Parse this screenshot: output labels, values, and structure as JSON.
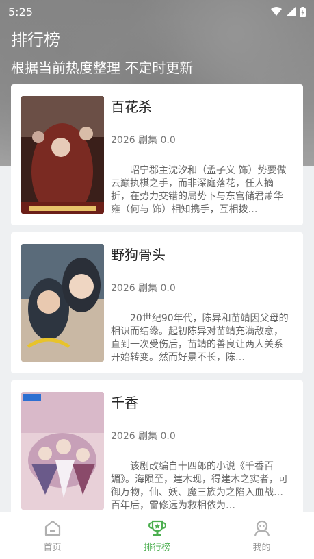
{
  "status": {
    "time": "5:25"
  },
  "header": {
    "title": "排行榜",
    "subtitle": "根据当前热度整理 不定时更新"
  },
  "items": [
    {
      "title": "百花杀",
      "meta": "2026 剧集 0.0",
      "desc": "昭宁郡主沈汐和（孟子义 饰）势要做云巅执棋之手，而非深庭落花，任人摘折，在势力交错的局势下与东宫储君萧华雍（何与 饰）相知携手，互相拨…",
      "poster_colors": [
        "#3a1f1a",
        "#7a2a22",
        "#c9a89a"
      ]
    },
    {
      "title": "野狗骨头",
      "meta": "2026 剧集 0.0",
      "desc": "20世纪90年代，陈异和苗靖因父母的相识而结缘。起初陈异对苗靖充满敌意，直到一次受伤后，苗靖的善良让两人关系开始转变。然而好景不长，陈…",
      "poster_colors": [
        "#5a6b7a",
        "#c9b8a4",
        "#2d3540"
      ]
    },
    {
      "title": "千香",
      "meta": "2026 剧集 0.0",
      "desc": "该剧改编自十四郎的小说《千香百媚》。海陨至，建木现，得建木之实者，可御万物，仙、妖、魔三族为之陷入血战… 百年后，雷修远为救相依为…",
      "poster_colors": [
        "#d9b9c9",
        "#6a5a8a",
        "#e8d0d8"
      ]
    }
  ],
  "tabs": [
    {
      "label": "首页",
      "icon": "home-icon",
      "active": false
    },
    {
      "label": "排行榜",
      "icon": "trophy-icon",
      "active": true
    },
    {
      "label": "我的",
      "icon": "user-icon",
      "active": false
    }
  ],
  "colors": {
    "accent": "#4caf50",
    "inactive": "#999999"
  }
}
